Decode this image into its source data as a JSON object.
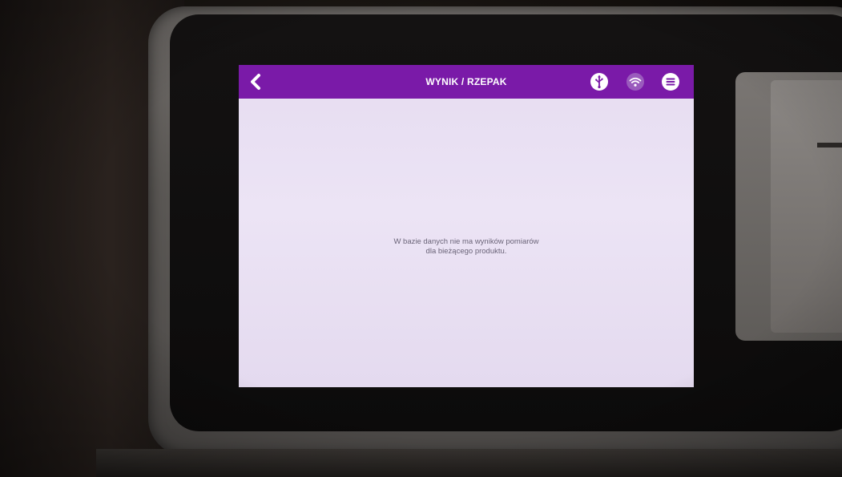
{
  "header": {
    "title": "WYNIK / RZEPAK",
    "back_icon": "chevron-left-icon",
    "status_icons": [
      "usb-icon",
      "wifi-icon",
      "menu-icon"
    ]
  },
  "content": {
    "message_line1": "W bazie danych nie ma wyników pomiarów",
    "message_line2": "dla bieżącego produktu."
  },
  "colors": {
    "header_bg": "#7a1aa8",
    "screen_bg": "#e8def2",
    "message_text": "#6a6478"
  }
}
